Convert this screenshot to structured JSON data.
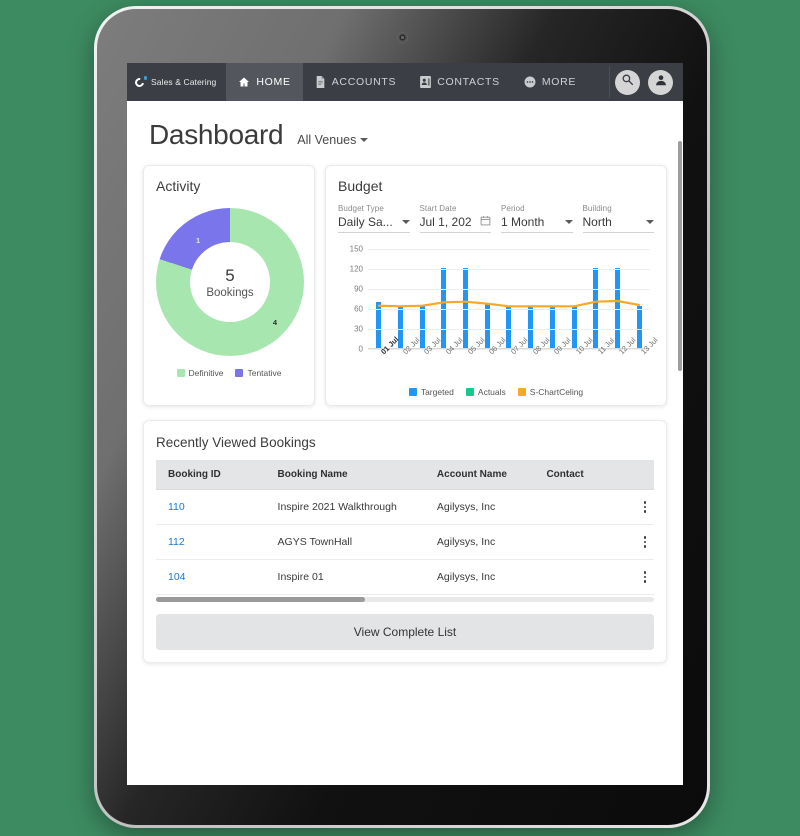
{
  "nav": {
    "brand": "Sales & Catering",
    "items": [
      {
        "label": "HOME",
        "icon": "home-icon",
        "active": true
      },
      {
        "label": "ACCOUNTS",
        "icon": "document-icon",
        "active": false
      },
      {
        "label": "CONTACTS",
        "icon": "contact-card-icon",
        "active": false
      },
      {
        "label": "MORE",
        "icon": "more-circle-icon",
        "active": false
      }
    ],
    "search_icon": "search-icon",
    "avatar_icon": "user-avatar-icon"
  },
  "header": {
    "title": "Dashboard",
    "venue_filter": "All Venues"
  },
  "activity": {
    "title": "Activity",
    "center_value": "5",
    "center_label": "Bookings",
    "slices": [
      {
        "label": "Definitive",
        "value": 4,
        "color": "#a8e6b0",
        "value_label": "4"
      },
      {
        "label": "Tentative",
        "value": 1,
        "color": "#7b75ec",
        "value_label": "1"
      }
    ]
  },
  "budget": {
    "title": "Budget",
    "controls": [
      {
        "label": "Budget Type",
        "value": "Daily Sa...",
        "type": "select"
      },
      {
        "label": "Start Date",
        "value": "Jul 1, 202",
        "type": "date"
      },
      {
        "label": "Period",
        "value": "1 Month",
        "type": "select"
      },
      {
        "label": "Building",
        "value": "North",
        "type": "select"
      }
    ]
  },
  "chart_data": {
    "type": "bar",
    "title": "Budget",
    "xlabel": "",
    "ylabel": "",
    "ylim": [
      0,
      150
    ],
    "yticks": [
      0,
      30,
      60,
      90,
      120,
      150
    ],
    "grid": true,
    "legend_position": "bottom",
    "categories": [
      "01 Jul",
      "02 Jul",
      "03 Jul",
      "04 Jul",
      "05 Jul",
      "06 Jul",
      "07 Jul",
      "08 Jul",
      "09 Jul",
      "10 Jul",
      "11 Jul",
      "12 Jul",
      "13 Jul"
    ],
    "series": [
      {
        "name": "Targeted",
        "type": "bar",
        "color": "#2196f3",
        "values": [
          70,
          65,
          65,
          122,
          122,
          68,
          65,
          65,
          65,
          65,
          122,
          122,
          65
        ]
      },
      {
        "name": "Actuals",
        "type": "bar",
        "color": "#18c98c",
        "values": [
          0,
          0,
          0,
          0,
          0,
          0,
          0,
          0,
          0,
          0,
          0,
          0,
          0
        ]
      },
      {
        "name": "S-ChartCeling",
        "type": "line",
        "color": "#f9a826",
        "values": [
          65,
          64,
          65,
          70,
          71,
          68,
          64,
          64,
          64,
          64,
          71,
          72,
          66
        ]
      }
    ]
  },
  "bookings": {
    "title": "Recently Viewed Bookings",
    "columns": [
      "Booking ID",
      "Booking Name",
      "Account Name",
      "Contact",
      ""
    ],
    "rows": [
      {
        "id": "110",
        "name": "Inspire 2021 Walkthrough",
        "account": "Agilysys, Inc",
        "contact": ""
      },
      {
        "id": "112",
        "name": "AGYS TownHall",
        "account": "Agilysys, Inc",
        "contact": ""
      },
      {
        "id": "104",
        "name": "Inspire 01",
        "account": "Agilysys, Inc",
        "contact": ""
      }
    ],
    "view_all": "View Complete List"
  }
}
